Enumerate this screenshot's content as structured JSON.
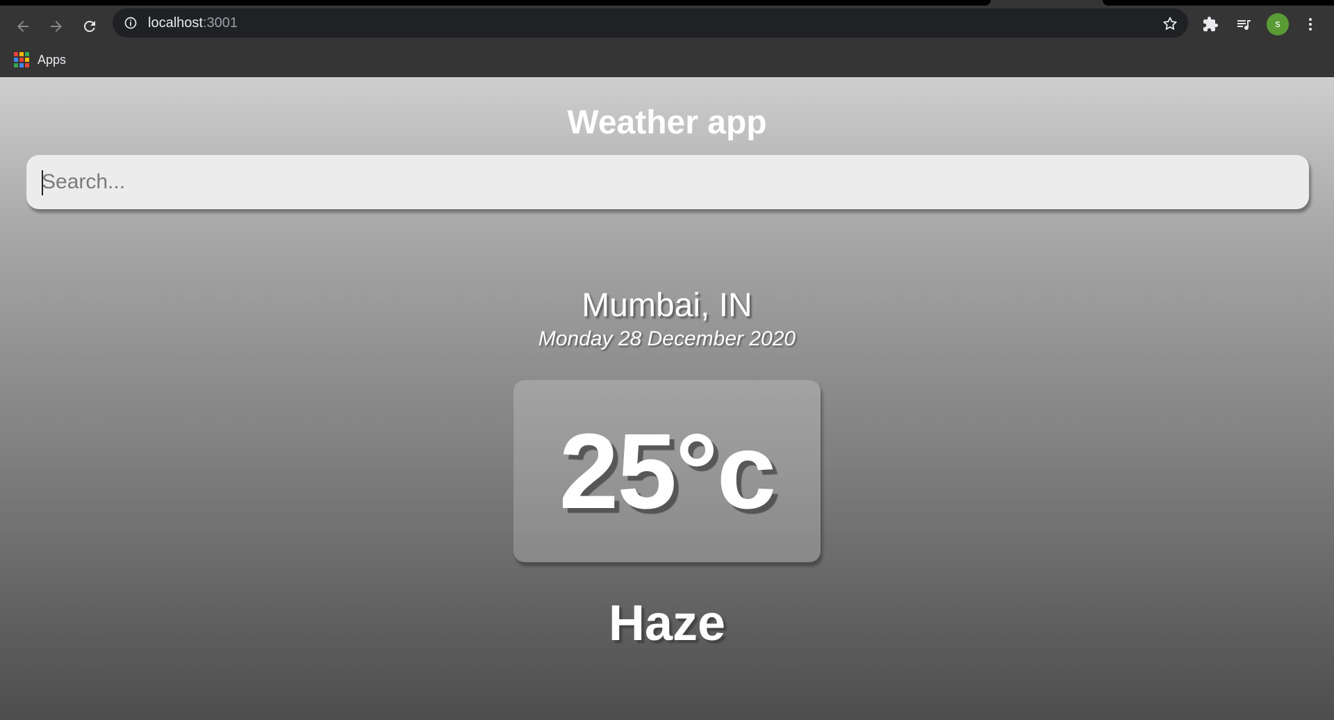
{
  "browser": {
    "url_host": "localhost",
    "url_port": ":3001",
    "bookmarks": [
      {
        "label": "Apps"
      }
    ],
    "profile_initial": "s",
    "apps_grid_colors": [
      "#ea4335",
      "#fbbc04",
      "#34a853",
      "#4285f4",
      "#ea4335",
      "#fbbc04",
      "#34a853",
      "#4285f4",
      "#ea4335"
    ]
  },
  "app": {
    "title": "Weather app",
    "search": {
      "placeholder": "Search...",
      "value": ""
    },
    "location": "Mumbai, IN",
    "date": "Monday 28 December 2020",
    "temperature": "25°c",
    "condition": "Haze"
  },
  "colors": {
    "chrome_bg": "#353535",
    "omnibox_bg": "#202124",
    "text_white": "#ffffff"
  }
}
